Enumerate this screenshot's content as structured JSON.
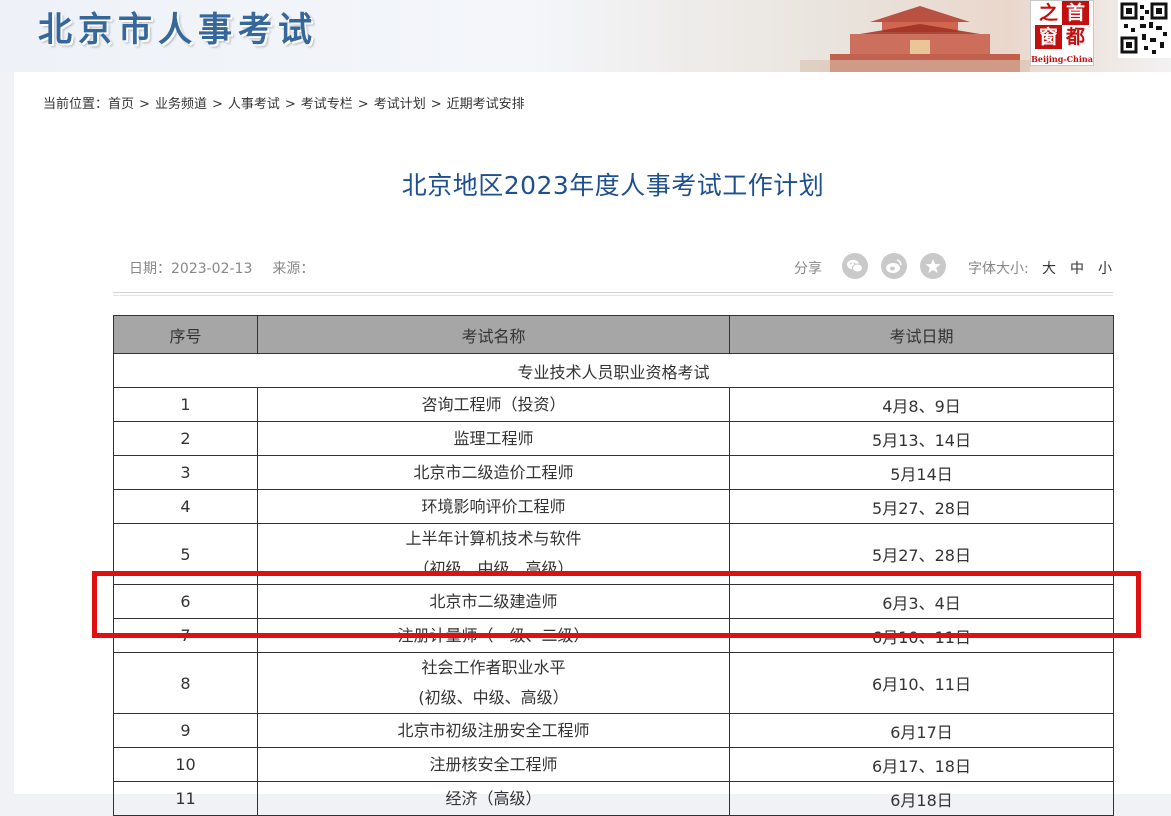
{
  "header": {
    "site_title": "北京市人事考试",
    "seal": {
      "chars": [
        "之",
        "首",
        "窗",
        "都"
      ],
      "subtitle": "Beijing-China"
    }
  },
  "breadcrumb": {
    "prefix": "当前位置：",
    "items": [
      "首页",
      "业务频道",
      "人事考试",
      "考试专栏",
      "考试计划",
      "近期考试安排"
    ],
    "separator": ">"
  },
  "article": {
    "title": "北京地区2023年度人事考试工作计划",
    "date_label": "日期：2023-02-13",
    "source_label": "来源：",
    "share_label": "分享",
    "share_icons": [
      "wechat-icon",
      "weibo-icon",
      "favorite-star-icon"
    ],
    "font_size_label": "字体大小:",
    "font_sizes": [
      "大",
      "中",
      "小"
    ]
  },
  "table": {
    "headers": [
      "序号",
      "考试名称",
      "考试日期"
    ],
    "section_title": "专业技术人员职业资格考试",
    "rows": [
      {
        "no": "1",
        "name": [
          "咨询工程师（投资）"
        ],
        "date": "4月8、9日"
      },
      {
        "no": "2",
        "name": [
          "监理工程师"
        ],
        "date": "5月13、14日"
      },
      {
        "no": "3",
        "name": [
          "北京市二级造价工程师"
        ],
        "date": "5月14日"
      },
      {
        "no": "4",
        "name": [
          "环境影响评价工程师"
        ],
        "date": "5月27、28日"
      },
      {
        "no": "5",
        "name": [
          "上半年计算机技术与软件",
          "（初级、中级、高级）"
        ],
        "date": "5月27、28日"
      },
      {
        "no": "6",
        "name": [
          "北京市二级建造师"
        ],
        "date": "6月3、4日"
      },
      {
        "no": "7",
        "name": [
          "注册计量师（一级、二级）"
        ],
        "date": "6月10、11日"
      },
      {
        "no": "8",
        "name": [
          "社会工作者职业水平",
          "(初级、中级、高级）"
        ],
        "date": "6月10、11日"
      },
      {
        "no": "9",
        "name": [
          "北京市初级注册安全工程师"
        ],
        "date": "6月17日"
      },
      {
        "no": "10",
        "name": [
          "注册核安全工程师"
        ],
        "date": "6月17、18日"
      },
      {
        "no": "11",
        "name": [
          "经济（高级）"
        ],
        "date": "6月18日"
      }
    ]
  },
  "colors": {
    "title_blue": "#1e4f8f",
    "header_gray": "#a6a6a6",
    "highlight_red": "#e01010"
  }
}
